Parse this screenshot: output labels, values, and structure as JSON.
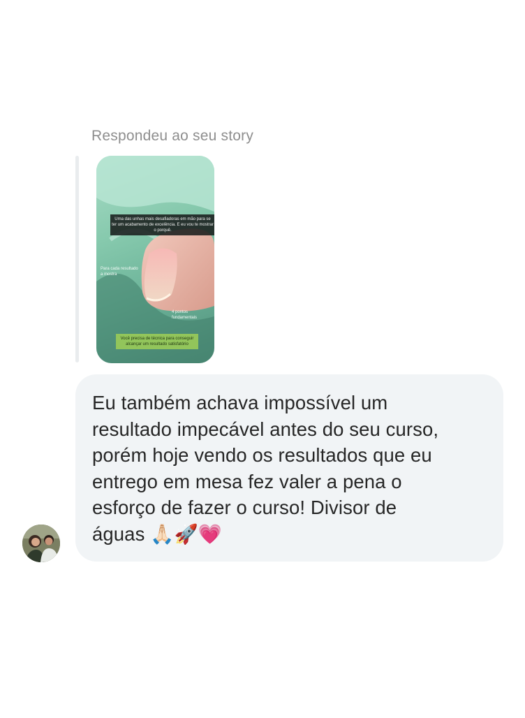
{
  "reply": {
    "header": "Respondeu ao seu story"
  },
  "story": {
    "caption_top": "Uma das unhas mais desafiadoras em mão para se ter um acabamento de excelência. E eu vou te mostrar o porquê.",
    "caption_left": "Para cada resultado a mostra",
    "caption_right": "4 pontos fundamentais",
    "caption_bottom": "Você precisa de técnica para conseguir alcançar um resultado satisfatório"
  },
  "message": {
    "lines": [
      "Eu também achava impossível um",
      "resultado impecável antes do seu curso,",
      "porém hoje vendo os resultados que eu",
      "entrego em mesa fez valer a pena o",
      "esforço de fazer o curso! Divisor de",
      "águas 🙏🏻🚀💗"
    ]
  },
  "colors": {
    "bubble": "#f1f4f6",
    "text": "#262626",
    "meta": "#8e8e8e"
  }
}
